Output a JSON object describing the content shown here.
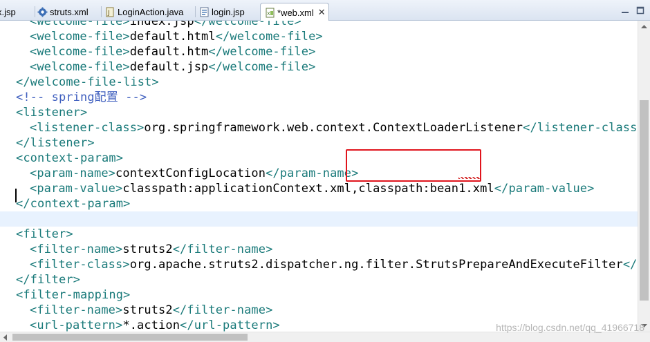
{
  "tabs": [
    {
      "label": "x.jsp",
      "icon": "jsp-file-icon",
      "active": false
    },
    {
      "label": "struts.xml",
      "icon": "gear-file-icon",
      "active": false
    },
    {
      "label": "LoginAction.java",
      "icon": "java-file-icon",
      "active": false
    },
    {
      "label": "login.jsp",
      "icon": "jsp-file-icon",
      "active": false
    },
    {
      "label": "*web.xml",
      "icon": "xml-file-icon",
      "active": true
    }
  ],
  "tab_close_glyph": "✕",
  "editor": {
    "lines": [
      {
        "segments": [
          {
            "t": "tag",
            "v": "<welcome-file>"
          },
          {
            "t": "txt",
            "v": "index.jsp"
          },
          {
            "t": "tag",
            "v": "</welcome-file>"
          }
        ],
        "indent": 2
      },
      {
        "segments": [
          {
            "t": "tag",
            "v": "<welcome-file>"
          },
          {
            "t": "txt",
            "v": "default.html"
          },
          {
            "t": "tag",
            "v": "</welcome-file>"
          }
        ],
        "indent": 2
      },
      {
        "segments": [
          {
            "t": "tag",
            "v": "<welcome-file>"
          },
          {
            "t": "txt",
            "v": "default.htm"
          },
          {
            "t": "tag",
            "v": "</welcome-file>"
          }
        ],
        "indent": 2
      },
      {
        "segments": [
          {
            "t": "tag",
            "v": "<welcome-file>"
          },
          {
            "t": "txt",
            "v": "default.jsp"
          },
          {
            "t": "tag",
            "v": "</welcome-file>"
          }
        ],
        "indent": 2
      },
      {
        "segments": [
          {
            "t": "tag",
            "v": "</welcome-file-list>"
          }
        ],
        "indent": 1
      },
      {
        "segments": [
          {
            "t": "cmt",
            "v": "<!-- spring配置 -->"
          }
        ],
        "indent": 1
      },
      {
        "segments": [
          {
            "t": "tag",
            "v": "<listener>"
          }
        ],
        "indent": 1
      },
      {
        "segments": [
          {
            "t": "tag",
            "v": "<listener-class>"
          },
          {
            "t": "txt",
            "v": "org.springframework.web.context.ContextLoaderListener"
          },
          {
            "t": "tag",
            "v": "</listener-class>"
          }
        ],
        "indent": 2
      },
      {
        "segments": [
          {
            "t": "tag",
            "v": "</listener>"
          }
        ],
        "indent": 1
      },
      {
        "segments": [
          {
            "t": "tag",
            "v": "<context-param>"
          }
        ],
        "indent": 1
      },
      {
        "segments": [
          {
            "t": "tag",
            "v": "<param-name>"
          },
          {
            "t": "txt",
            "v": "contextConfigLocation"
          },
          {
            "t": "tag",
            "v": "</param-name>"
          }
        ],
        "indent": 2
      },
      {
        "segments": [
          {
            "t": "tag",
            "v": "<param-value>"
          },
          {
            "t": "txt",
            "v": "classpath:applicationContext.xml,classpath:bean1.xml"
          },
          {
            "t": "tag",
            "v": "</param-value>"
          }
        ],
        "indent": 2
      },
      {
        "segments": [
          {
            "t": "tag",
            "v": "</context-param>"
          }
        ],
        "indent": 1
      },
      {
        "segments": [],
        "indent": 1,
        "current": true
      },
      {
        "segments": [
          {
            "t": "tag",
            "v": "<filter>"
          }
        ],
        "indent": 1
      },
      {
        "segments": [
          {
            "t": "tag",
            "v": "<filter-name>"
          },
          {
            "t": "txt",
            "v": "struts2"
          },
          {
            "t": "tag",
            "v": "</filter-name>"
          }
        ],
        "indent": 2
      },
      {
        "segments": [
          {
            "t": "tag",
            "v": "<filter-class>"
          },
          {
            "t": "txt",
            "v": "org.apache.struts2.dispatcher.ng.filter.StrutsPrepareAndExecuteFilter"
          },
          {
            "t": "tag",
            "v": "</fil"
          }
        ],
        "indent": 2
      },
      {
        "segments": [
          {
            "t": "tag",
            "v": "</filter>"
          }
        ],
        "indent": 1
      },
      {
        "segments": [
          {
            "t": "tag",
            "v": "<filter-mapping>"
          }
        ],
        "indent": 1
      },
      {
        "segments": [
          {
            "t": "tag",
            "v": "<filter-name>"
          },
          {
            "t": "txt",
            "v": "struts2"
          },
          {
            "t": "tag",
            "v": "</filter-name>"
          }
        ],
        "indent": 2
      },
      {
        "segments": [
          {
            "t": "tag",
            "v": "<url-pattern>"
          },
          {
            "t": "txt",
            "v": "*.action"
          },
          {
            "t": "tag",
            "v": "</url-pattern>"
          }
        ],
        "indent": 2
      }
    ]
  },
  "colors": {
    "tag": "#1a7a7a",
    "comment": "#3f5fbf",
    "text": "#000000",
    "current_line": "#e8f2fe",
    "highlight_box": "#e0141c"
  },
  "watermark": "https://blog.csdn.net/qq_41966718"
}
